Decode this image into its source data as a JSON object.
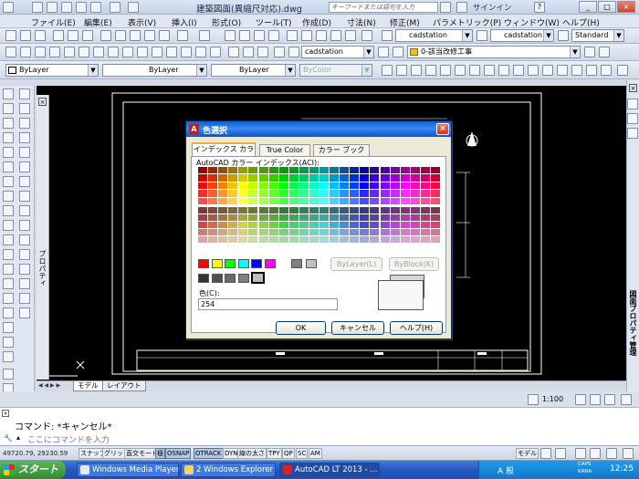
{
  "window": {
    "title": "建築図面(異縮尺対応).dwg",
    "search_placeholder": "キーワードまたは語句を入力",
    "sign_in": "サインイン",
    "help_icon": "?",
    "min": "_",
    "max": "□",
    "close": "×"
  },
  "menu": [
    "ファイル(E)",
    "編集(E)",
    "表示(V)",
    "挿入(I)",
    "形式(O)",
    "ツール(T)",
    "作成(D)",
    "寸法(N)",
    "修正(M)",
    "パラメトリック(P)",
    "ウィンドウ(W)",
    "ヘルプ(H)"
  ],
  "toolbar": {
    "text_style": "cadstation",
    "dim_style": "cadstation",
    "table_style": "Standard",
    "layer": "ByLayer",
    "linetype": "ByLayer",
    "lineweight": "ByLayer",
    "color": "ByColor",
    "annotation_style": "cadstation",
    "layer_name": "0-該当改修工事"
  },
  "palette": {
    "left_title": "プロパティ",
    "right_title": "図面プロパティ管理"
  },
  "tabs": [
    "モデル",
    "レイアウト"
  ],
  "scale": "1:100",
  "command": {
    "line1": "コマンド: *キャンセル*",
    "prompt": "ここにコマンドを入力"
  },
  "status": {
    "coords": "49720.79, 29230.59",
    "buttons": [
      {
        "label": "スナップ",
        "on": false
      },
      {
        "label": "グリッド",
        "on": false
      },
      {
        "label": "直交モード",
        "on": false
      },
      {
        "label": "極",
        "on": true
      },
      {
        "label": "OSNAP",
        "on": true
      },
      {
        "label": "OTRACK",
        "on": true
      },
      {
        "label": "DYN",
        "on": false
      },
      {
        "label": "線の太さ",
        "on": false
      },
      {
        "label": "TPY",
        "on": false
      },
      {
        "label": "QP",
        "on": false
      },
      {
        "label": "SC",
        "on": false
      },
      {
        "label": "AM",
        "on": false
      }
    ],
    "model": "モデル"
  },
  "taskbar": {
    "start": "スタート",
    "tasks": [
      {
        "label": "Windows Media Player",
        "active": false
      },
      {
        "label": "2 Windows Explorer",
        "active": false
      },
      {
        "label": "AutoCAD LT 2013 - ...",
        "active": true
      }
    ],
    "ime": "A 般",
    "caps": "CAPS",
    "kana": "KANA",
    "clock": "12:25"
  },
  "dialog": {
    "title": "色選択",
    "tabs": [
      "インデックス カラー",
      "True Color",
      "カラー ブック"
    ],
    "selected_tab": 0,
    "aci_label": "AutoCAD カラー インデックス(ACI):",
    "bylayer": "ByLayer(L)",
    "byblock": "ByBlock(K)",
    "color_label": "色(C):",
    "color_value": "254",
    "ok": "OK",
    "cancel": "キャンセル",
    "help": "ヘルプ(H)",
    "standard_colors": [
      "#ff0000",
      "#ffff00",
      "#00ff00",
      "#00ffff",
      "#0000ff",
      "#ff00ff",
      "#ffffff"
    ],
    "gray_colors": [
      "#333333",
      "#505050",
      "#696969",
      "#808080",
      "#bebebe",
      "#ffffff"
    ],
    "gray_selected": 4,
    "extra_grays": [
      "#808080",
      "#c0c0c0"
    ]
  }
}
